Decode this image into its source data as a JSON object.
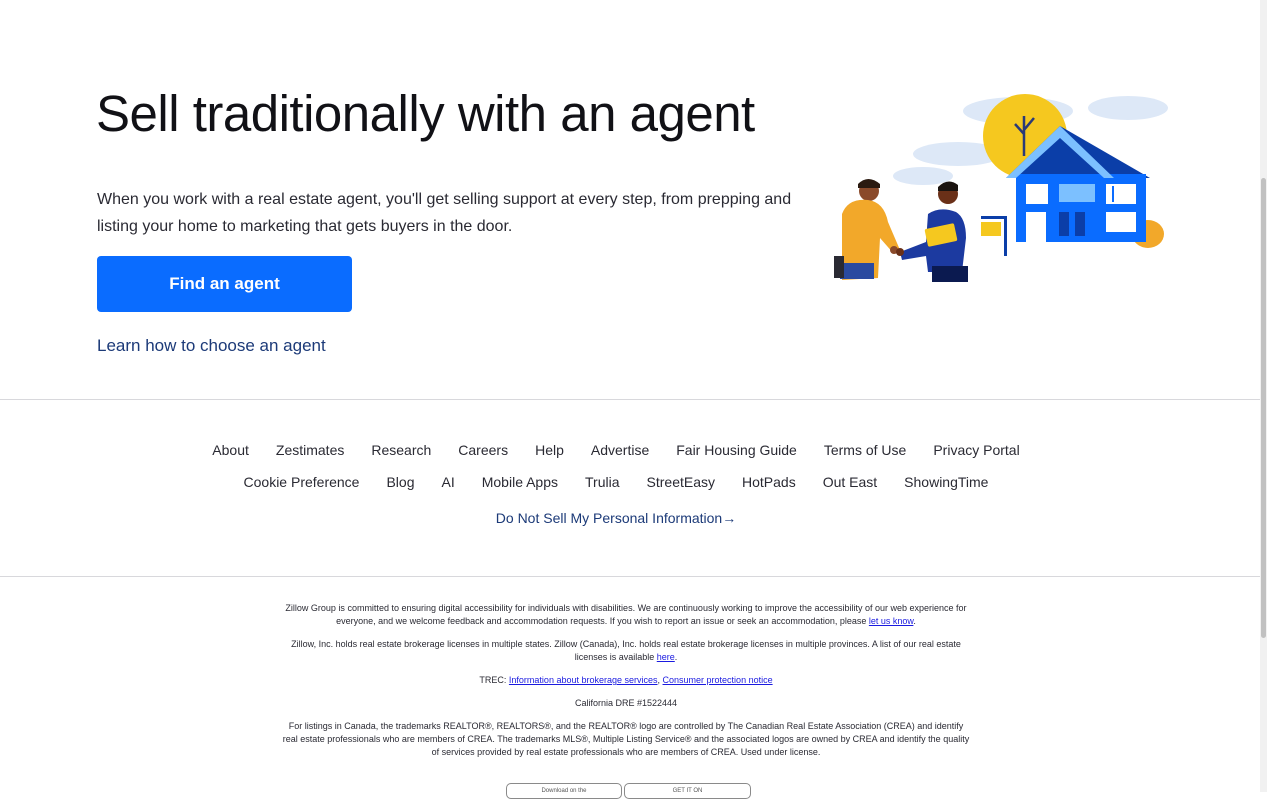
{
  "hero": {
    "title": "Sell traditionally with an agent",
    "description": "When you work with a real estate agent, you'll get selling support at every step, from prepping and listing your home to marketing that gets buyers in the door.",
    "cta_label": "Find an agent",
    "learn_link": "Learn how to choose an agent"
  },
  "illustration": {
    "icon": "agent-handshake-house-illustration"
  },
  "footer": {
    "row1": [
      "About",
      "Zestimates",
      "Research",
      "Careers",
      "Help",
      "Advertise",
      "Fair Housing Guide",
      "Terms of Use",
      "Privacy Portal"
    ],
    "row2": [
      "Cookie Preference",
      "Blog",
      "AI",
      "Mobile Apps",
      "Trulia",
      "StreetEasy",
      "HotPads",
      "Out East",
      "ShowingTime"
    ],
    "do_not_sell": "Do Not Sell My Personal Information→"
  },
  "legal": {
    "accessibility_text": "Zillow Group is committed to ensuring digital accessibility for individuals with disabilities. We are continuously working to improve the accessibility of our web experience for everyone, and we welcome feedback and accommodation requests. If you wish to report an issue or seek an accommodation, please ",
    "accessibility_link": "let us know",
    "licenses_text": "Zillow, Inc. holds real estate brokerage licenses in multiple states. Zillow (Canada), Inc. holds real estate brokerage licenses in multiple provinces. A list of our real estate licenses is available ",
    "licenses_link": "here",
    "trec_label": "TREC: ",
    "trec_link1": "Information about brokerage services",
    "trec_link2": "Consumer protection notice",
    "dre": "California DRE #1522444",
    "canada": "For listings in Canada, the trademarks REALTOR®, REALTORS®, and the REALTOR® logo are controlled by The Canadian Real Estate Association (CREA) and identify real estate professionals who are members of CREA. The trademarks MLS®, Multiple Listing Service® and the associated logos are owned by CREA and identify the quality of services provided by real estate professionals who are members of CREA. Used under license.",
    "badge1": "Download on the",
    "badge2": "GET IT ON"
  },
  "colors": {
    "primary": "#0a6cff",
    "link": "#1c3a78",
    "house_blue": "#0a52e0",
    "sun_yellow": "#f5c81f",
    "shirt_orange": "#f2a82a"
  }
}
